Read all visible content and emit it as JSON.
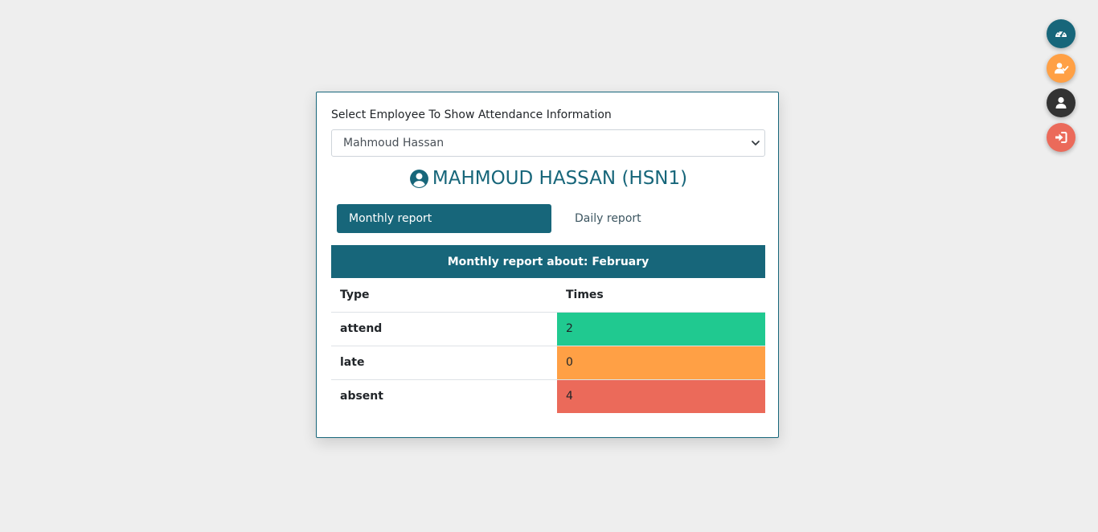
{
  "colors": {
    "primary": "#17667a",
    "orange": "#ffa045",
    "dark": "#333333",
    "red": "#eb6a5a",
    "green": "#20c990"
  },
  "fabs": [
    {
      "name": "dashboard",
      "icon": "speedometer-icon",
      "color": "#17667a"
    },
    {
      "name": "attendance",
      "icon": "user-check-icon",
      "color": "#ffa045"
    },
    {
      "name": "profile",
      "icon": "user-icon",
      "color": "#333333"
    },
    {
      "name": "logout",
      "icon": "sign-in-icon",
      "color": "#eb6a5a"
    }
  ],
  "employee_select": {
    "label": "Select Employee To Show Attendance Information",
    "selected": "Mahmoud Hassan"
  },
  "employee": {
    "title": "MAHMOUD HASSAN (HSN1)"
  },
  "tabs": {
    "monthly": "Monthly report",
    "daily": "Daily report"
  },
  "report": {
    "header": "Monthly report about: February",
    "columns": [
      "Type",
      "Times"
    ],
    "rows": [
      {
        "type": "attend",
        "times": "2",
        "color": "#20c990"
      },
      {
        "type": "late",
        "times": "0",
        "color": "#ffa045"
      },
      {
        "type": "absent",
        "times": "4",
        "color": "#eb6a5a"
      }
    ]
  }
}
